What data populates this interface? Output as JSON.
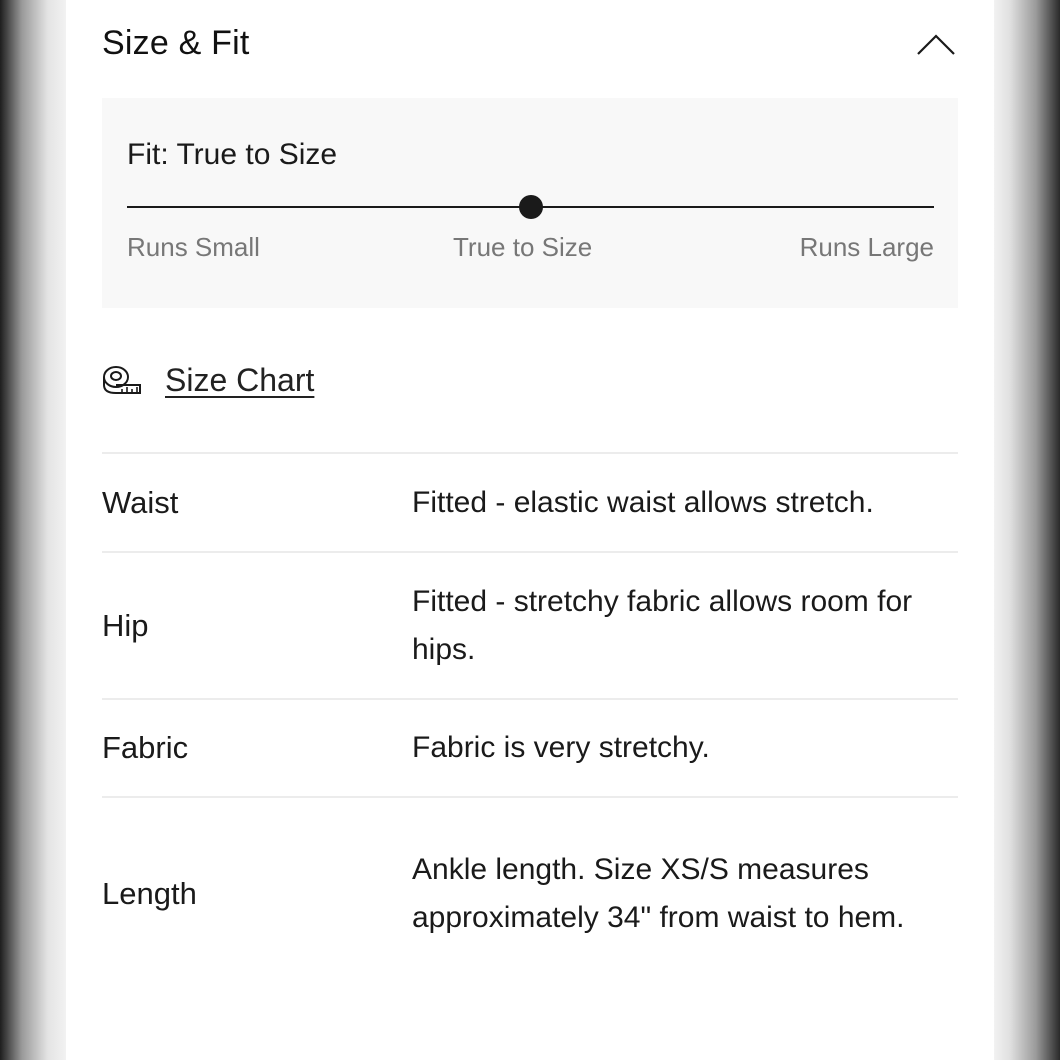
{
  "section": {
    "title": "Size & Fit",
    "collapse_icon": "chevron-up-icon"
  },
  "fit": {
    "title": "Fit: True to Size",
    "scale_labels": [
      "Runs Small",
      "True to Size",
      "Runs Large"
    ],
    "selected_position": 0.5
  },
  "size_chart": {
    "icon": "tape-measure-icon",
    "label": "Size Chart"
  },
  "specs": [
    {
      "label": "Waist",
      "value": "Fitted - elastic waist allows stretch."
    },
    {
      "label": "Hip",
      "value": "Fitted - stretchy fabric allows room for hips."
    },
    {
      "label": "Fabric",
      "value": "Fabric is very stretchy."
    },
    {
      "label": "Length",
      "value": "Ankle length. Size XS/S measures approximately 34\" from waist to hem."
    }
  ]
}
